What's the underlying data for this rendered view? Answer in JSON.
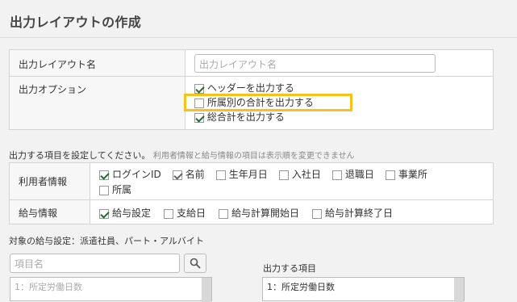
{
  "page": {
    "title": "出力レイアウトの作成"
  },
  "form": {
    "layout_name_label": "出力レイアウト名",
    "layout_name_placeholder": "出力レイアウト名",
    "options_label": "出力オプション",
    "options": [
      {
        "label": "ヘッダーを出力する",
        "checked": true
      },
      {
        "label": "所属別の合計を出力する",
        "checked": false
      },
      {
        "label": "総合計を出力する",
        "checked": true
      }
    ]
  },
  "items_section": {
    "instruction": "出力する項目を設定してください。",
    "note": "利用者情報と給与情報の項目は表示順を変更できません",
    "user_info": {
      "label": "利用者情報",
      "items": [
        {
          "label": "ログインID",
          "checked": true,
          "disabled": false
        },
        {
          "label": "名前",
          "checked": true,
          "disabled": true
        },
        {
          "label": "生年月日",
          "checked": false,
          "disabled": false
        },
        {
          "label": "入社日",
          "checked": false,
          "disabled": false
        },
        {
          "label": "退職日",
          "checked": false,
          "disabled": false
        },
        {
          "label": "事業所",
          "checked": false,
          "disabled": false
        },
        {
          "label": "所属",
          "checked": false,
          "disabled": false
        }
      ]
    },
    "salary_info": {
      "label": "給与情報",
      "items": [
        {
          "label": "給与設定",
          "checked": true
        },
        {
          "label": "支給日",
          "checked": false
        },
        {
          "label": "給与計算開始日",
          "checked": false
        },
        {
          "label": "給与計算終了日",
          "checked": false
        }
      ]
    }
  },
  "target": {
    "label": "対象の給与設定：派遣社員、パート・アルバイト",
    "search_placeholder": "項目名",
    "search_icon": "magnifier-icon",
    "available_first_item": "1：所定労働日数",
    "output_label": "出力する項目",
    "output_first_item": "1：所定労働日数"
  },
  "colors": {
    "highlight": "#f7c01b",
    "check": "#1f6f2f"
  }
}
